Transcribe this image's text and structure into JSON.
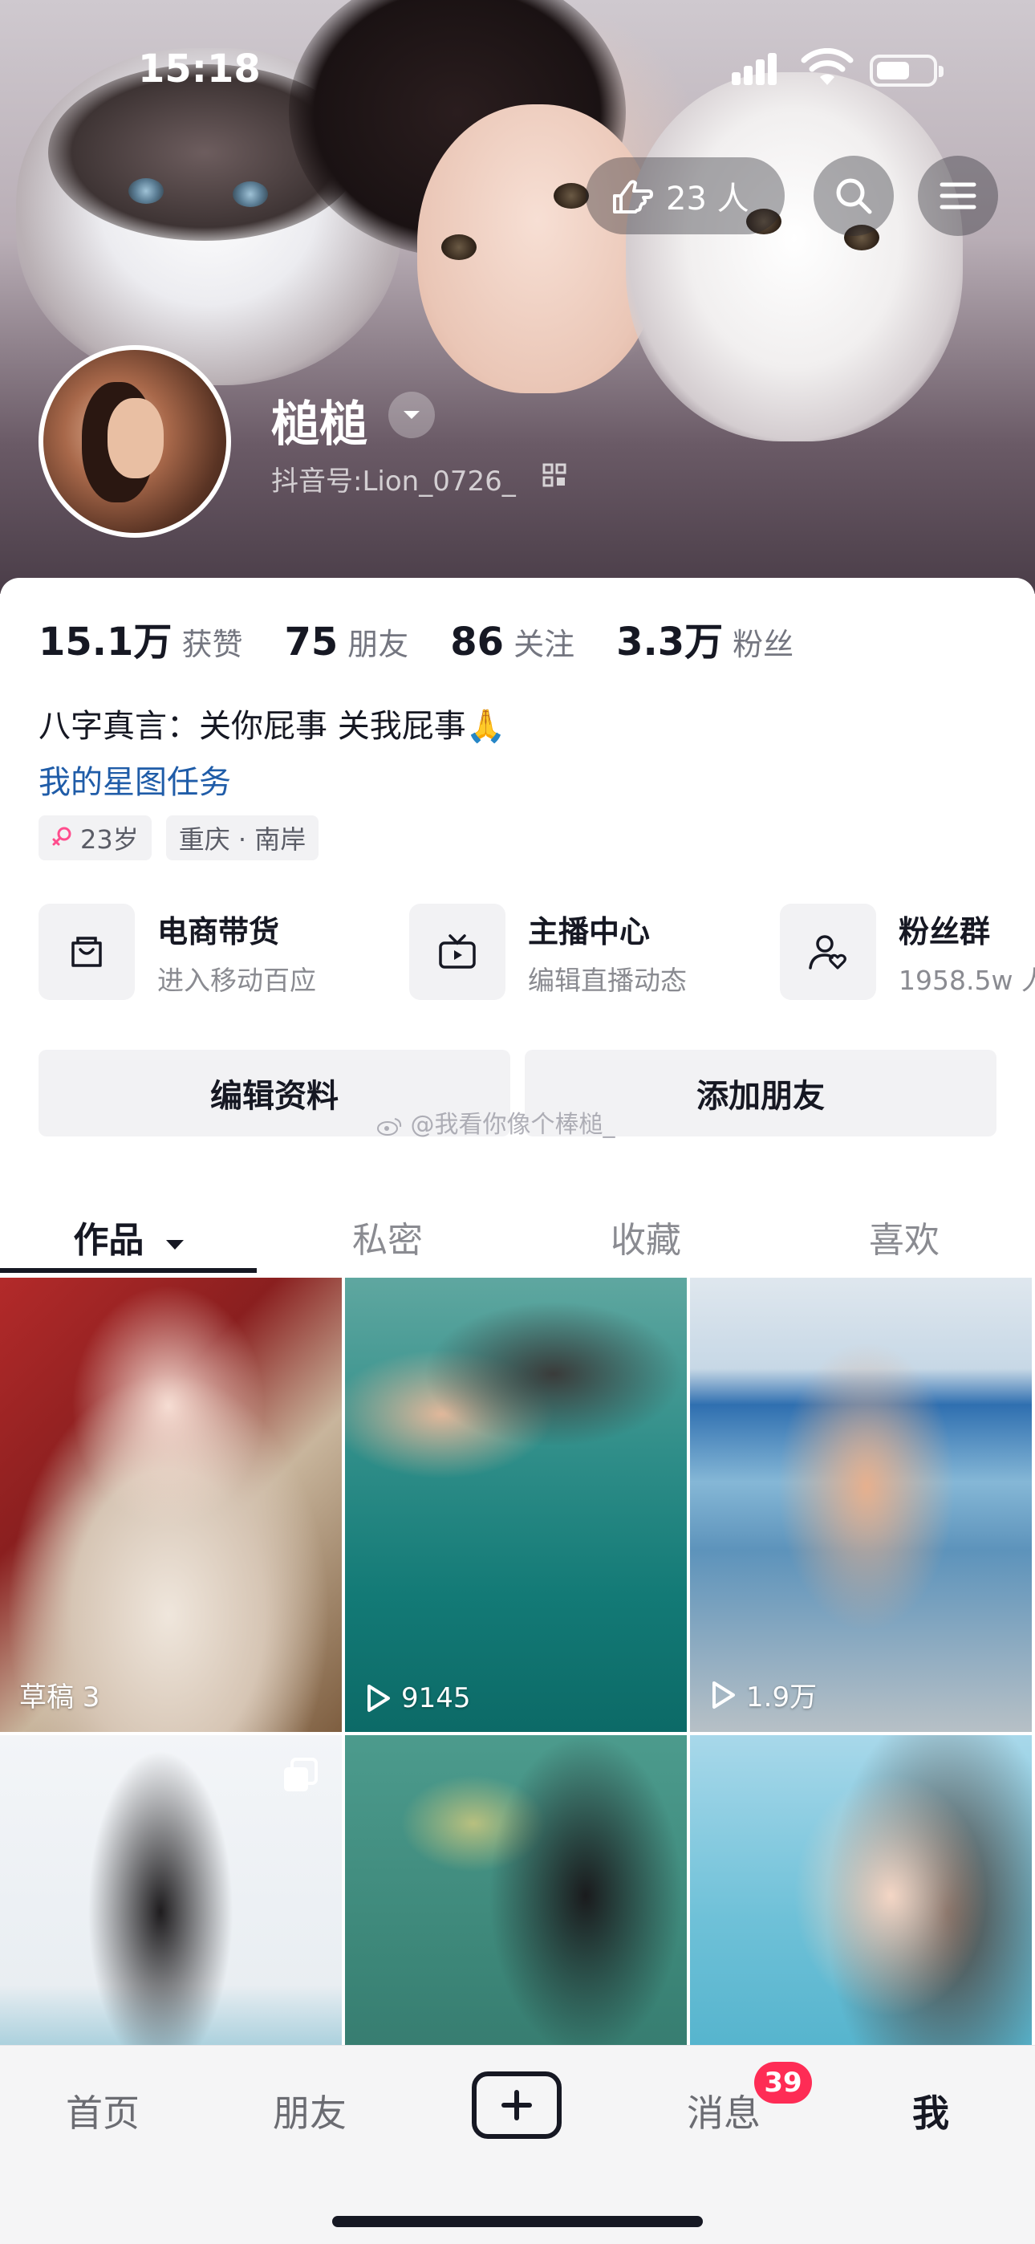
{
  "status_bar": {
    "time": "15:18"
  },
  "header": {
    "visitors": "23 人",
    "nickname": "槌槌",
    "douyin_id": "抖音号:Lion_0726_"
  },
  "stats": [
    {
      "num": "15.1万",
      "label": "获赞"
    },
    {
      "num": "75",
      "label": "朋友"
    },
    {
      "num": "86",
      "label": "关注"
    },
    {
      "num": "3.3万",
      "label": "粉丝"
    }
  ],
  "bio": {
    "text": "八字真言：关你屁事 关我屁事🙏",
    "task_link": "我的星图任务"
  },
  "tags": {
    "age": "23岁",
    "location": "重庆 · 南岸"
  },
  "services": [
    {
      "title": "电商带货",
      "subtitle": "进入移动百应"
    },
    {
      "title": "主播中心",
      "subtitle": "编辑直播动态"
    },
    {
      "title": "粉丝群",
      "subtitle": "1958.5w 人"
    }
  ],
  "buttons": {
    "edit_profile": "编辑资料",
    "add_friend": "添加朋友"
  },
  "watermark": "@我看你像个棒槌_",
  "tabs": [
    "作品",
    "私密",
    "收藏",
    "喜欢"
  ],
  "grid": [
    {
      "overlay": "草稿 3"
    },
    {
      "overlay": "9145"
    },
    {
      "overlay": "1.9万"
    }
  ],
  "bottom_nav": {
    "home": "首页",
    "friends": "朋友",
    "messages": "消息",
    "me": "我",
    "messages_badge": "39"
  },
  "colors": {
    "accent_red": "#fe2c55",
    "link_blue": "#1f5ca8",
    "text_primary": "#161823"
  }
}
